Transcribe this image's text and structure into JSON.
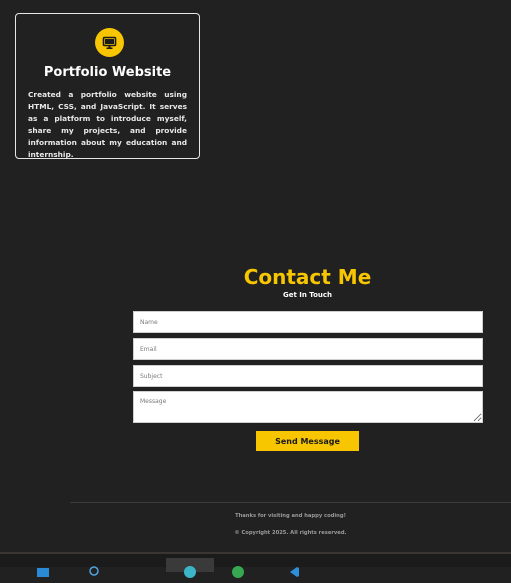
{
  "project_card": {
    "icon": "monitor-icon",
    "title": "Portfolio Website",
    "description": "Created a portfolio website using HTML, CSS, and JavaScript. It serves as a platform to introduce myself, share my projects, and provide information about my education and internship."
  },
  "contact": {
    "title": "Contact Me",
    "subtitle": "Get In Touch",
    "fields": {
      "name_placeholder": "Name",
      "email_placeholder": "Email",
      "subject_placeholder": "Subject",
      "message_placeholder": "Message"
    },
    "send_label": "Send Message"
  },
  "footer": {
    "thanks": "Thanks for visiting and happy coding!",
    "copyright": "© Copyright 2025. All rights reserved."
  },
  "taskbar": {
    "icons": [
      "file-explorer-icon",
      "search-icon",
      "edge-browser-icon",
      "chrome-icon",
      "vscode-icon"
    ]
  },
  "colors": {
    "accent": "#f7c600",
    "background": "#212121"
  }
}
